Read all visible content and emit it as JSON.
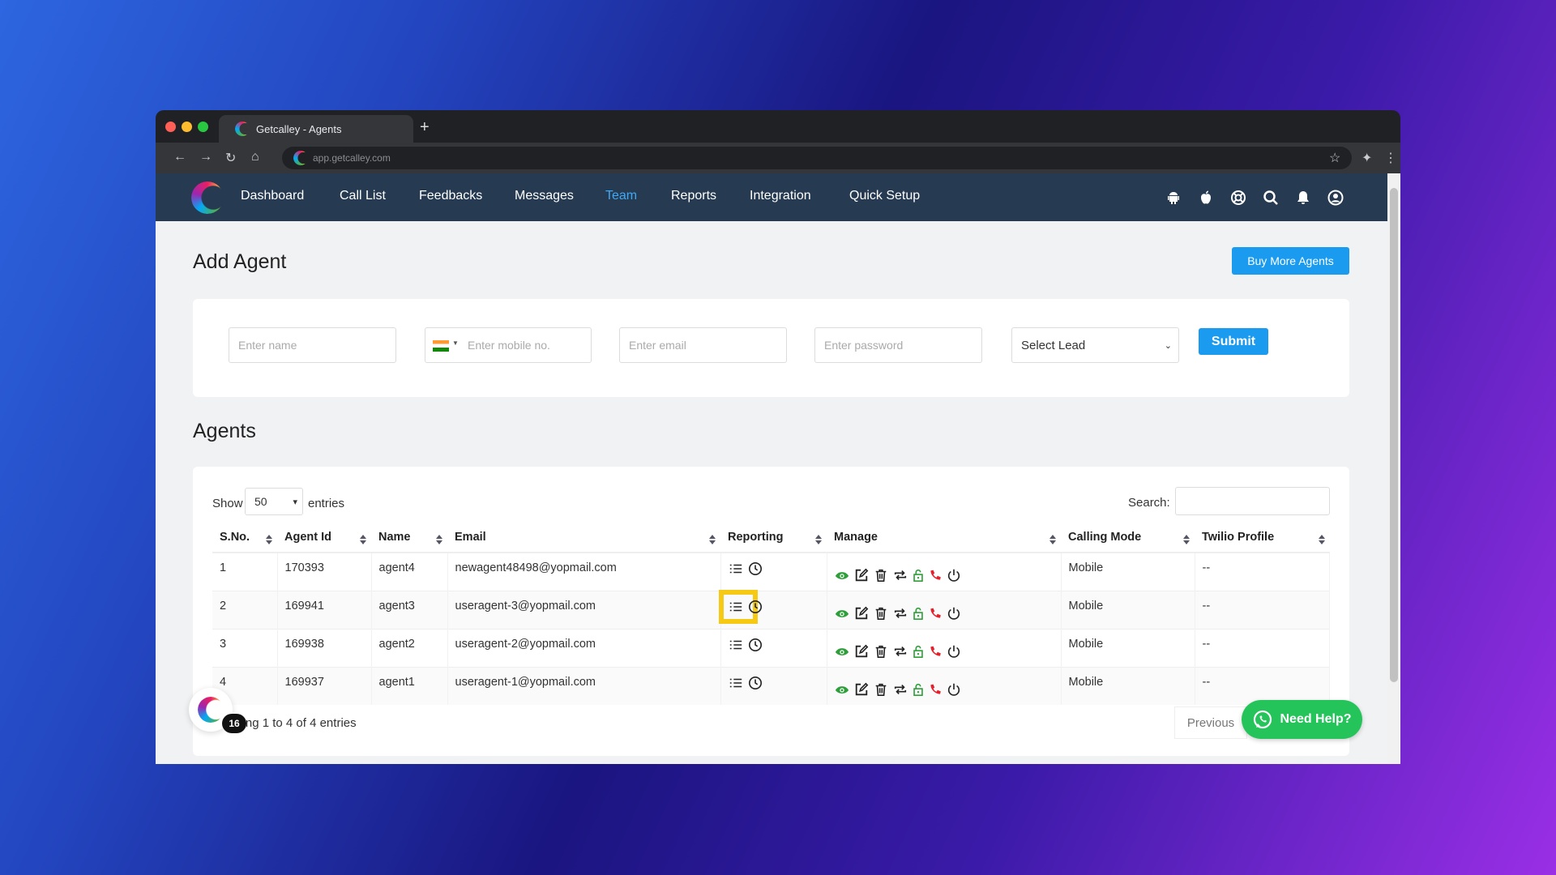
{
  "browser": {
    "tab_title": "Getcalley - Agents",
    "url": "app.getcalley.com",
    "new_tab": "+"
  },
  "nav": {
    "items": [
      {
        "label": "Dashboard"
      },
      {
        "label": "Call List"
      },
      {
        "label": "Feedbacks"
      },
      {
        "label": "Messages"
      },
      {
        "label": "Team",
        "active": true
      },
      {
        "label": "Reports"
      },
      {
        "label": "Integration"
      },
      {
        "label": "Quick Setup"
      }
    ],
    "icons": [
      "android-icon",
      "apple-icon",
      "support-icon",
      "search-icon",
      "bell-icon",
      "user-icon"
    ],
    "active_color": "#3fa9f5"
  },
  "add_agent": {
    "title": "Add Agent",
    "buy_more": "Buy More Agents",
    "name_placeholder": "Enter name",
    "mobile_placeholder": "Enter mobile no.",
    "email_placeholder": "Enter email",
    "password_placeholder": "Enter password",
    "lead_select": "Select Lead",
    "submit": "Submit"
  },
  "agents": {
    "title": "Agents",
    "show_label": "Show",
    "entries_value": "50",
    "entries_label": "entries",
    "search_label": "Search:",
    "columns": [
      "S.No.",
      "Agent Id",
      "Name",
      "Email",
      "Reporting",
      "Manage",
      "Calling Mode",
      "Twilio Profile"
    ],
    "rows": [
      {
        "sno": "1",
        "id": "170393",
        "name": "agent4",
        "email": "newagent48498@yopmail.com",
        "mode": "Mobile",
        "twilio": "--"
      },
      {
        "sno": "2",
        "id": "169941",
        "name": "agent3",
        "email": "useragent-3@yopmail.com",
        "mode": "Mobile",
        "twilio": "--"
      },
      {
        "sno": "3",
        "id": "169938",
        "name": "agent2",
        "email": "useragent-2@yopmail.com",
        "mode": "Mobile",
        "twilio": "--"
      },
      {
        "sno": "4",
        "id": "169937",
        "name": "agent1",
        "email": "useragent-1@yopmail.com",
        "mode": "Mobile",
        "twilio": "--"
      }
    ],
    "footer": "Showing 1 to 4 of 4 entries",
    "previous": "Previous"
  },
  "widget": {
    "badge": "16",
    "need_help": "Need Help?"
  },
  "colors": {
    "accent": "#1a9bf0",
    "nav_bg": "#263a52",
    "whatsapp": "#25c45a",
    "highlight": "#f6c915"
  }
}
